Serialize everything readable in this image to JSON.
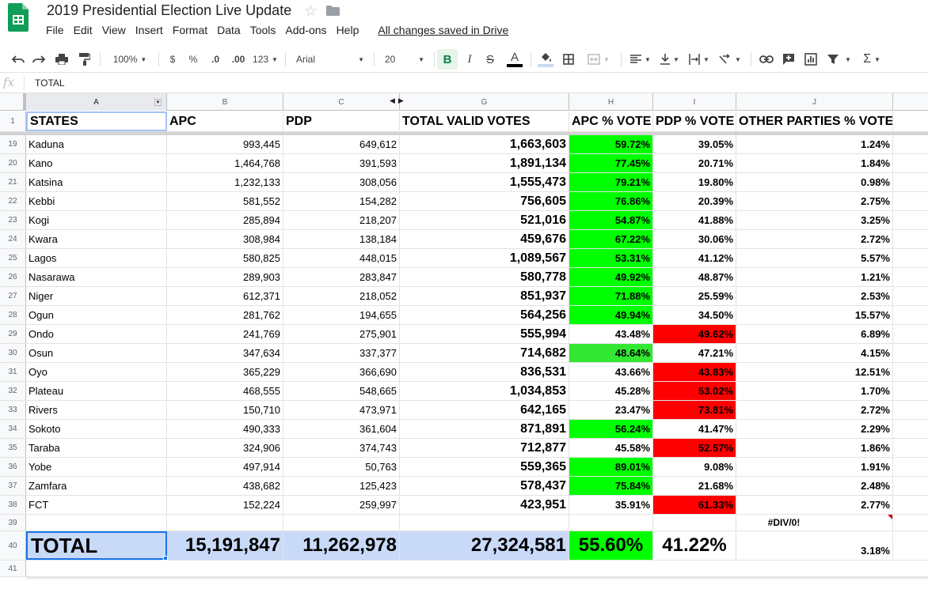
{
  "app": {
    "title": "2019 Presidential Election Live Update",
    "menu": [
      "File",
      "Edit",
      "View",
      "Insert",
      "Format",
      "Data",
      "Tools",
      "Add-ons",
      "Help"
    ],
    "saved_status": "All changes saved in Drive"
  },
  "toolbar": {
    "zoom": "100%",
    "currency": "$",
    "percent": "%",
    "decrease_decimal": ".0",
    "increase_decimal": ".00",
    "more_formats": "123",
    "font": "Arial",
    "font_size": "20",
    "bold": "B",
    "italic": "I",
    "strikethrough": "S",
    "text_color": "A",
    "sum": "Σ"
  },
  "formula_bar": {
    "fx": "fx",
    "content": "TOTAL"
  },
  "colors": {
    "green": "#00ff00",
    "red": "#ff0000",
    "selection_blue": "#c9daf8"
  },
  "grid": {
    "column_letters": [
      "A",
      "B",
      "C",
      "G",
      "H",
      "I",
      "J"
    ],
    "header_row_number": "1",
    "headers": [
      "STATES",
      "APC",
      "PDP",
      "TOTAL VALID VOTES",
      "APC % VOTE",
      "PDP % VOTE",
      "OTHER PARTIES % VOTE"
    ],
    "rows": [
      {
        "n": "19",
        "state": "Kaduna",
        "apc": "993,445",
        "pdp": "649,612",
        "total": "1,663,603",
        "apc_pct": "59.72%",
        "pdp_pct": "39.05%",
        "other_pct": "1.24%",
        "apc_color": "green",
        "pdp_color": ""
      },
      {
        "n": "20",
        "state": "Kano",
        "apc": "1,464,768",
        "pdp": "391,593",
        "total": "1,891,134",
        "apc_pct": "77.45%",
        "pdp_pct": "20.71%",
        "other_pct": "1.84%",
        "apc_color": "green",
        "pdp_color": ""
      },
      {
        "n": "21",
        "state": "Katsina",
        "apc": "1,232,133",
        "pdp": "308,056",
        "total": "1,555,473",
        "apc_pct": "79.21%",
        "pdp_pct": "19.80%",
        "other_pct": "0.98%",
        "apc_color": "green",
        "pdp_color": ""
      },
      {
        "n": "22",
        "state": "Kebbi",
        "apc": "581,552",
        "pdp": "154,282",
        "total": "756,605",
        "apc_pct": "76.86%",
        "pdp_pct": "20.39%",
        "other_pct": "2.75%",
        "apc_color": "green",
        "pdp_color": ""
      },
      {
        "n": "23",
        "state": "Kogi",
        "apc": "285,894",
        "pdp": "218,207",
        "total": "521,016",
        "apc_pct": "54.87%",
        "pdp_pct": "41.88%",
        "other_pct": "3.25%",
        "apc_color": "green",
        "pdp_color": ""
      },
      {
        "n": "24",
        "state": "Kwara",
        "apc": "308,984",
        "pdp": "138,184",
        "total": "459,676",
        "apc_pct": "67.22%",
        "pdp_pct": "30.06%",
        "other_pct": "2.72%",
        "apc_color": "green",
        "pdp_color": ""
      },
      {
        "n": "25",
        "state": "Lagos",
        "apc": "580,825",
        "pdp": "448,015",
        "total": "1,089,567",
        "apc_pct": "53.31%",
        "pdp_pct": "41.12%",
        "other_pct": "5.57%",
        "apc_color": "green",
        "pdp_color": ""
      },
      {
        "n": "26",
        "state": "Nasarawa",
        "apc": "289,903",
        "pdp": "283,847",
        "total": "580,778",
        "apc_pct": "49.92%",
        "pdp_pct": "48.87%",
        "other_pct": "1.21%",
        "apc_color": "green",
        "pdp_color": ""
      },
      {
        "n": "27",
        "state": "Niger",
        "apc": "612,371",
        "pdp": "218,052",
        "total": "851,937",
        "apc_pct": "71.88%",
        "pdp_pct": "25.59%",
        "other_pct": "2.53%",
        "apc_color": "green",
        "pdp_color": ""
      },
      {
        "n": "28",
        "state": "Ogun",
        "apc": "281,762",
        "pdp": "194,655",
        "total": "564,256",
        "apc_pct": "49.94%",
        "pdp_pct": "34.50%",
        "other_pct": "15.57%",
        "apc_color": "green",
        "pdp_color": ""
      },
      {
        "n": "29",
        "state": "Ondo",
        "apc": "241,769",
        "pdp": "275,901",
        "total": "555,994",
        "apc_pct": "43.48%",
        "pdp_pct": "49.62%",
        "other_pct": "6.89%",
        "apc_color": "",
        "pdp_color": "red"
      },
      {
        "n": "30",
        "state": "Osun",
        "apc": "347,634",
        "pdp": "337,377",
        "total": "714,682",
        "apc_pct": "48.64%",
        "pdp_pct": "47.21%",
        "other_pct": "4.15%",
        "apc_color": "green2",
        "pdp_color": ""
      },
      {
        "n": "31",
        "state": "Oyo",
        "apc": "365,229",
        "pdp": "366,690",
        "total": "836,531",
        "apc_pct": "43.66%",
        "pdp_pct": "43.83%",
        "other_pct": "12.51%",
        "apc_color": "",
        "pdp_color": "red"
      },
      {
        "n": "32",
        "state": "Plateau",
        "apc": "468,555",
        "pdp": "548,665",
        "total": "1,034,853",
        "apc_pct": "45.28%",
        "pdp_pct": "53.02%",
        "other_pct": "1.70%",
        "apc_color": "",
        "pdp_color": "red"
      },
      {
        "n": "33",
        "state": "Rivers",
        "apc": "150,710",
        "pdp": "473,971",
        "total": "642,165",
        "apc_pct": "23.47%",
        "pdp_pct": "73.81%",
        "other_pct": "2.72%",
        "apc_color": "",
        "pdp_color": "red"
      },
      {
        "n": "34",
        "state": "Sokoto",
        "apc": "490,333",
        "pdp": "361,604",
        "total": "871,891",
        "apc_pct": "56.24%",
        "pdp_pct": "41.47%",
        "other_pct": "2.29%",
        "apc_color": "green",
        "pdp_color": ""
      },
      {
        "n": "35",
        "state": "Taraba",
        "apc": "324,906",
        "pdp": "374,743",
        "total": "712,877",
        "apc_pct": "45.58%",
        "pdp_pct": "52.57%",
        "other_pct": "1.86%",
        "apc_color": "",
        "pdp_color": "red"
      },
      {
        "n": "36",
        "state": "Yobe",
        "apc": "497,914",
        "pdp": "50,763",
        "total": "559,365",
        "apc_pct": "89.01%",
        "pdp_pct": "9.08%",
        "other_pct": "1.91%",
        "apc_color": "green",
        "pdp_color": ""
      },
      {
        "n": "37",
        "state": "Zamfara",
        "apc": "438,682",
        "pdp": "125,423",
        "total": "578,437",
        "apc_pct": "75.84%",
        "pdp_pct": "21.68%",
        "other_pct": "2.48%",
        "apc_color": "green",
        "pdp_color": ""
      },
      {
        "n": "38",
        "state": "FCT",
        "apc": "152,224",
        "pdp": "259,997",
        "total": "423,951",
        "apc_pct": "35.91%",
        "pdp_pct": "61.33%",
        "other_pct": "2.77%",
        "apc_color": "",
        "pdp_color": "red"
      }
    ],
    "row39": {
      "n": "39",
      "error": "#DIV/0!"
    },
    "total_row": {
      "n": "40",
      "label": "TOTAL",
      "apc": "15,191,847",
      "pdp": "11,262,978",
      "total": "27,324,581",
      "apc_pct": "55.60%",
      "pdp_pct": "41.22%",
      "other_pct": "3.18%"
    },
    "row41": {
      "n": "41"
    }
  }
}
